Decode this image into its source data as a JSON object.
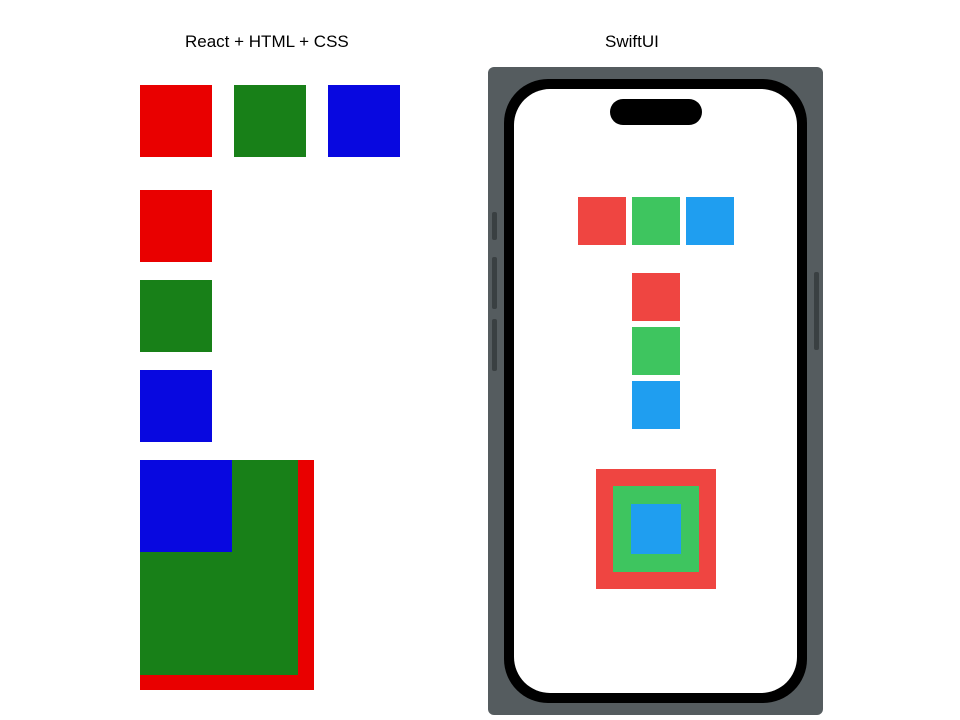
{
  "labels": {
    "left": "React + HTML + CSS",
    "right": "SwiftUI"
  },
  "colors": {
    "web": {
      "red": "#e90000",
      "green": "#188018",
      "blue": "#0808e0"
    },
    "ios": {
      "red": "#ef4541",
      "green": "#3ec55f",
      "blue": "#1f9ef0"
    }
  },
  "left_examples": {
    "hstack": [
      "red",
      "green",
      "blue"
    ],
    "vstack": [
      "red",
      "green",
      "blue"
    ],
    "zstack_layers": [
      "red",
      "green",
      "blue"
    ],
    "zstack_alignment": "top-left"
  },
  "right_examples": {
    "hstack": [
      "red",
      "green",
      "blue"
    ],
    "vstack": [
      "red",
      "green",
      "blue"
    ],
    "zstack_layers": [
      "red",
      "green",
      "blue"
    ],
    "zstack_alignment": "center"
  }
}
